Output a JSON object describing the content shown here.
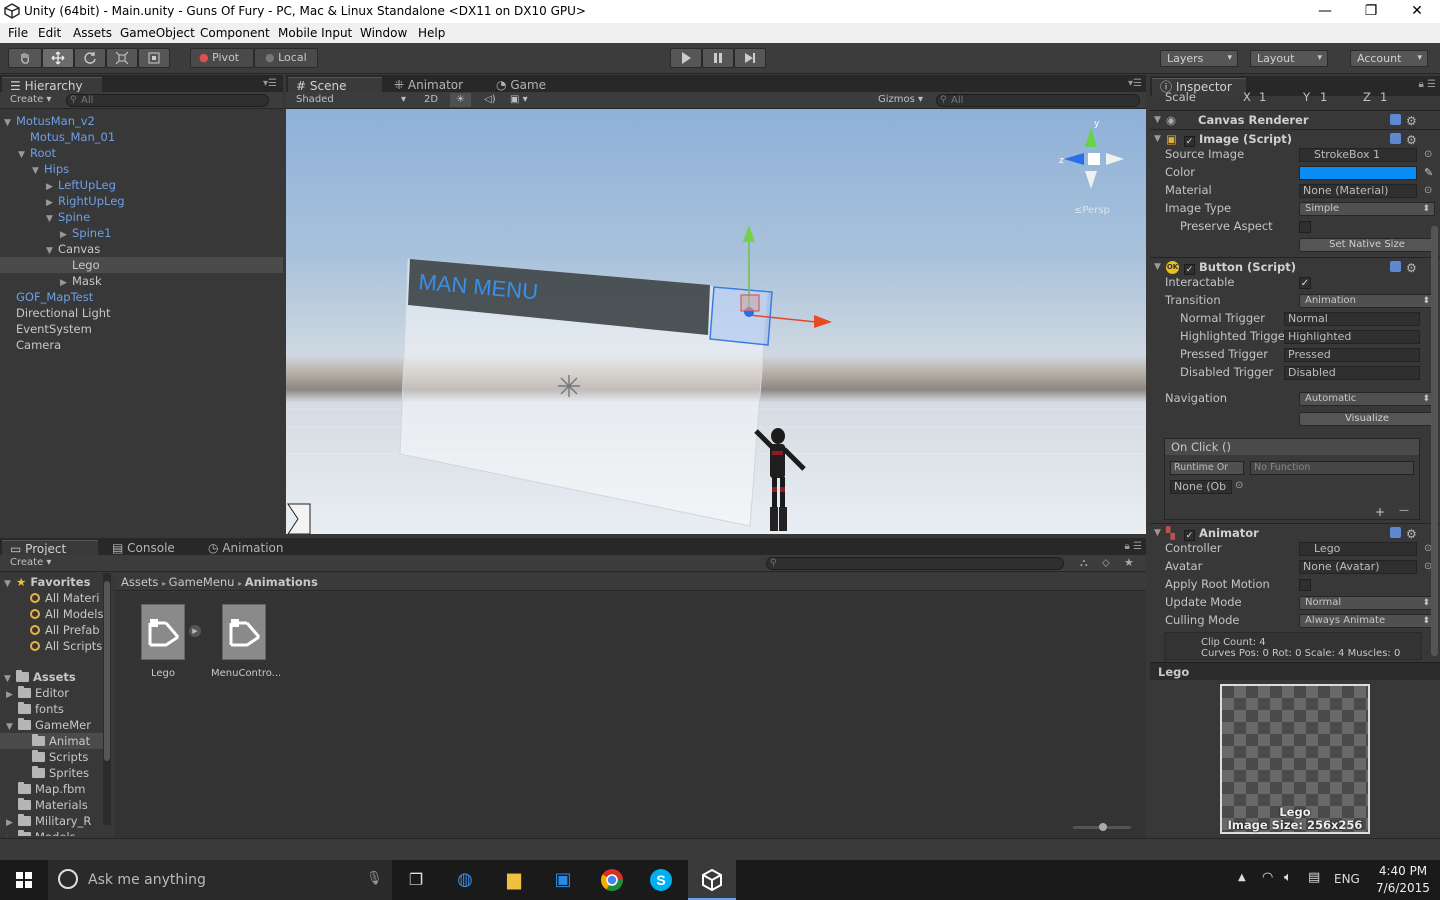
{
  "window": {
    "title": "Unity (64bit) - Main.unity - Guns Of Fury - PC, Mac & Linux Standalone <DX11 on DX10 GPU>",
    "minimize": "—",
    "maximize": "❐",
    "close": "✕"
  },
  "menu": [
    "File",
    "Edit",
    "Assets",
    "GameObject",
    "Component",
    "Mobile Input",
    "Window",
    "Help"
  ],
  "toolbar": {
    "pivot": "Pivot",
    "local": "Local",
    "layers": "Layers",
    "layout": "Layout",
    "account": "Account"
  },
  "hierarchy": {
    "tab": "Hierarchy",
    "create": "Create",
    "search_placeholder": "All",
    "items": [
      {
        "label": "MotusMan_v2",
        "depth": 0,
        "color": "blue",
        "arrow": "▼"
      },
      {
        "label": "Motus_Man_01",
        "depth": 1,
        "color": "blue",
        "arrow": ""
      },
      {
        "label": "Root",
        "depth": 1,
        "color": "blue",
        "arrow": "▼"
      },
      {
        "label": "Hips",
        "depth": 2,
        "color": "blue",
        "arrow": "▼"
      },
      {
        "label": "LeftUpLeg",
        "depth": 3,
        "color": "blue",
        "arrow": "▶"
      },
      {
        "label": "RightUpLeg",
        "depth": 3,
        "color": "blue",
        "arrow": "▶"
      },
      {
        "label": "Spine",
        "depth": 3,
        "color": "blue",
        "arrow": "▼"
      },
      {
        "label": "Spine1",
        "depth": 4,
        "color": "blue",
        "arrow": "▶"
      },
      {
        "label": "Canvas",
        "depth": 3,
        "color": "white",
        "arrow": "▼"
      },
      {
        "label": "Lego",
        "depth": 4,
        "color": "white",
        "arrow": "",
        "selected": true
      },
      {
        "label": "Mask",
        "depth": 4,
        "color": "white",
        "arrow": "▶"
      },
      {
        "label": "GOF_MapTest",
        "depth": 0,
        "color": "blue",
        "arrow": ""
      },
      {
        "label": "Directional Light",
        "depth": 0,
        "color": "white",
        "arrow": ""
      },
      {
        "label": "EventSystem",
        "depth": 0,
        "color": "white",
        "arrow": ""
      },
      {
        "label": "Camera",
        "depth": 0,
        "color": "white",
        "arrow": ""
      }
    ]
  },
  "scene": {
    "tabs": [
      "Scene",
      "Animator",
      "Game"
    ],
    "shading": "Shaded",
    "mode_2d": "2D",
    "gizmos": "Gizmos",
    "search_placeholder": "All",
    "menu_text": "MAN MENU",
    "axis_y": "y",
    "axis_z": "z",
    "persp": "≤Persp"
  },
  "inspector": {
    "tab": "Inspector",
    "scale": {
      "label": "Scale",
      "x_label": "X",
      "x": "1",
      "y_label": "Y",
      "y": "1",
      "z_label": "Z",
      "z": "1"
    },
    "canvas_renderer": "Canvas Renderer",
    "image": {
      "title": "Image (Script)",
      "source_image_label": "Source Image",
      "source_image": "StrokeBox 1",
      "color_label": "Color",
      "color": "#0a8cf5",
      "material_label": "Material",
      "material": "None (Material)",
      "image_type_label": "Image Type",
      "image_type": "Simple",
      "preserve_aspect_label": "Preserve Aspect",
      "set_native_size": "Set Native Size"
    },
    "button": {
      "title": "Button (Script)",
      "interactable_label": "Interactable",
      "transition_label": "Transition",
      "transition": "Animation",
      "normal_label": "Normal Trigger",
      "normal": "Normal",
      "highlighted_label": "Highlighted Trigge",
      "highlighted": "Highlighted",
      "pressed_label": "Pressed Trigger",
      "pressed": "Pressed",
      "disabled_label": "Disabled Trigger",
      "disabled": "Disabled",
      "navigation_label": "Navigation",
      "navigation": "Automatic",
      "visualize": "Visualize",
      "on_click": "On Click ()",
      "runtime": "Runtime Or",
      "no_function": "No Function",
      "none_obj": "None (Ob",
      "plus": "+",
      "minus": "—"
    },
    "animator": {
      "title": "Animator",
      "controller_label": "Controller",
      "controller": "Lego",
      "avatar_label": "Avatar",
      "avatar": "None (Avatar)",
      "apply_root_label": "Apply Root Motion",
      "update_mode_label": "Update Mode",
      "update_mode": "Normal",
      "culling_label": "Culling Mode",
      "culling": "Always Animate",
      "clip_count": "Clip Count: 4",
      "curves": "Curves Pos: 0 Rot: 0 Scale: 4 Muscles: 0"
    },
    "preview": {
      "title": "Lego",
      "name": "Lego",
      "size": "Image Size: 256x256"
    }
  },
  "project": {
    "tabs": [
      "Project",
      "Console",
      "Animation"
    ],
    "create": "Create",
    "favorites_label": "Favorites",
    "favorites": [
      "All Materi",
      "All Models",
      "All Prefab",
      "All Scripts"
    ],
    "assets_label": "Assets",
    "tree": [
      {
        "label": "Editor",
        "depth": 1,
        "arrow": "▶"
      },
      {
        "label": "fonts",
        "depth": 1,
        "arrow": ""
      },
      {
        "label": "GameMer",
        "depth": 1,
        "arrow": "▼"
      },
      {
        "label": "Animat",
        "depth": 2,
        "arrow": "",
        "selected": true
      },
      {
        "label": "Scripts",
        "depth": 2,
        "arrow": ""
      },
      {
        "label": "Sprites",
        "depth": 2,
        "arrow": ""
      },
      {
        "label": "Map.fbm",
        "depth": 1,
        "arrow": ""
      },
      {
        "label": "Materials",
        "depth": 1,
        "arrow": ""
      },
      {
        "label": "Military_R",
        "depth": 1,
        "arrow": "▶"
      },
      {
        "label": "Models",
        "depth": 1,
        "arrow": "▶"
      }
    ],
    "breadcrumb": [
      "Assets",
      "GameMenu",
      "Animations"
    ],
    "files": [
      "Lego",
      "MenuContro..."
    ]
  },
  "taskbar": {
    "search": "Ask me anything",
    "lang": "ENG",
    "time": "4:40 PM",
    "date": "7/6/2015"
  }
}
